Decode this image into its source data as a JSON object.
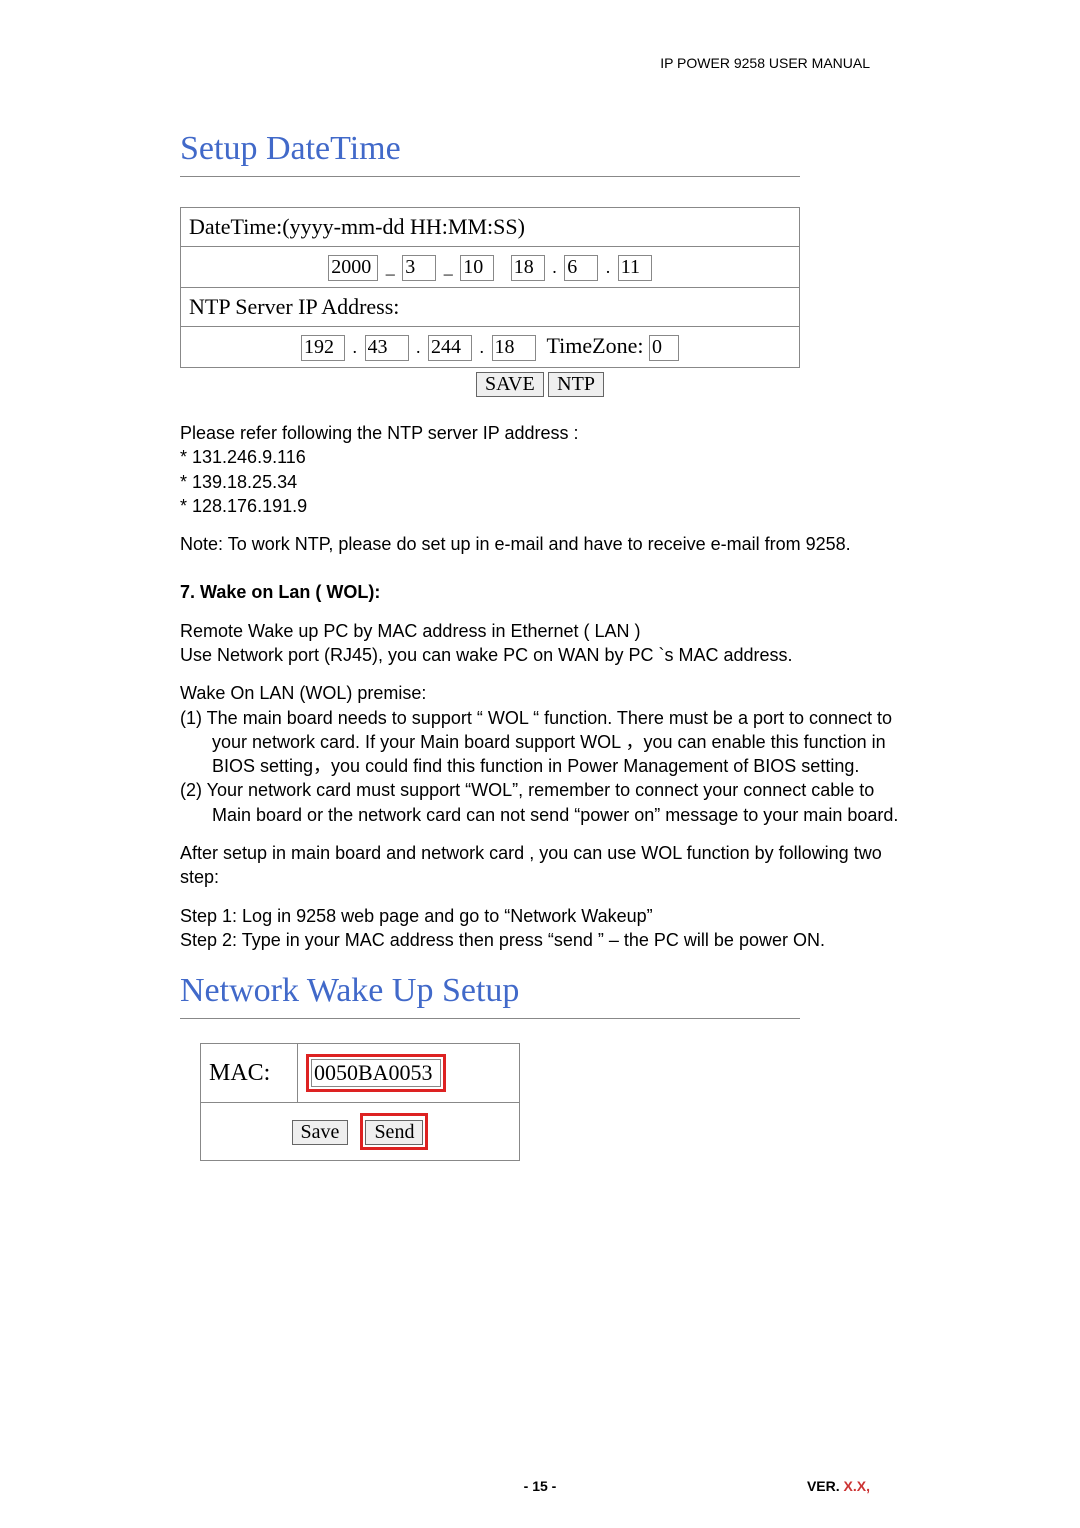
{
  "header": {
    "right": "IP POWER 9258 USER MANUAL"
  },
  "section1": {
    "title": "Setup DateTime",
    "datetime_label": "DateTime:(yyyy-mm-dd HH:MM:SS)",
    "dt": {
      "yyyy": "2000",
      "mm": "3",
      "dd": "10",
      "HH": "18",
      "MM": "6",
      "SS": "11"
    },
    "dash": "_",
    "dot": ".",
    "ntp_label": "NTP Server IP Address:",
    "ip": {
      "a": "192",
      "b": "43",
      "c": "244",
      "d": "18"
    },
    "tz_label": "TimeZone:",
    "tz_value": "0",
    "save_btn": "SAVE",
    "ntp_btn": "NTP"
  },
  "body": {
    "p1": "Please refer following the NTP server IP address :",
    "l1": "* 131.246.9.116",
    "l2": "* 139.18.25.34",
    "l3": "* 128.176.191.9",
    "note": "Note:  To work NTP, please do set up in  e-mail and have to receive e-mail from 9258.",
    "h7": "7. Wake on Lan ( WOL):",
    "wol1": "Remote Wake up PC by MAC address in Ethernet ( LAN )",
    "wol2": "Use Network port (RJ45), you can wake PC on WAN  by PC `s MAC address.",
    "premise": "Wake On LAN (WOL) premise:",
    "pt1": "(1) The main board needs to support “ WOL “ function. There must be a port to connect to your network card. If your Main board support  WOL ，you can enable this function in BIOS setting，you could find this function in  Power Management of BIOS setting.",
    "pt2": "(2) Your network card must support “WOL”, remember to connect your connect cable to Main board or the network card can not send “power on” message to your main board.",
    "after": "After setup in main board and network card , you can use WOL function by following two step:",
    "step1": "Step 1: Log in 9258 web page and go to “Network Wakeup”",
    "step2": "Step 2: Type in your MAC address then press “send ” – the PC will be power ON."
  },
  "section2": {
    "title": "Network Wake Up Setup",
    "mac_label": "MAC:",
    "mac_value": "0050BA0053",
    "save_btn": "Save",
    "send_btn": "Send"
  },
  "footer": {
    "page": "- 15 -",
    "ver_prefix": "VER. ",
    "ver_value": "X.X,"
  }
}
